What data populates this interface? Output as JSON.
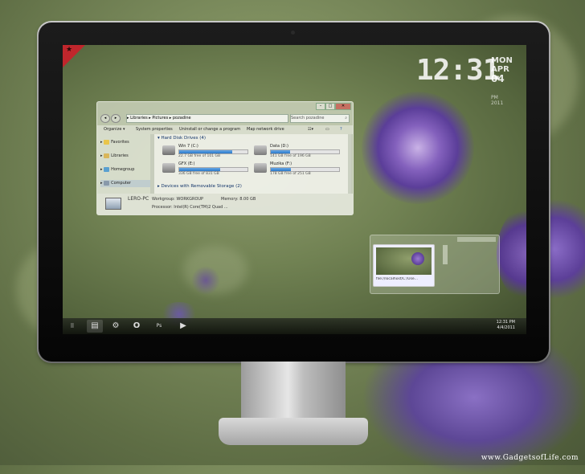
{
  "clock": {
    "time": "12:31",
    "month_top": "MON",
    "month": "APR",
    "day": "04",
    "year": "PM 2011"
  },
  "explorer": {
    "window_controls": [
      "–",
      "□",
      "✕"
    ],
    "breadcrumb": "▸ Libraries ▸ Pictures ▸ pozadine",
    "search_placeholder": "Search pozadine",
    "commands": [
      "Organize ▾",
      "System properties",
      "Uninstall or change a program",
      "Map network drive"
    ],
    "nav": [
      {
        "label": "Favorites",
        "color": "#e9c54a"
      },
      {
        "label": "Libraries",
        "color": "#d9b65a"
      },
      {
        "label": "Homegroup",
        "color": "#5aa0d0"
      },
      {
        "label": "Computer",
        "color": "#8899aa"
      }
    ],
    "groups": {
      "hdd": "Hard Disk Drives (4)",
      "removable": "Devices with Removable Storage (2)"
    },
    "drives": [
      {
        "name": "Win 7 (C:)",
        "free": "22.7 GB free of 101 GB",
        "used": 0.78
      },
      {
        "name": "Data (D:)",
        "free": "141 GB free of 196 GB",
        "used": 0.28
      },
      {
        "name": "GFX (E:)",
        "free": "336 GB free of 831 GB",
        "used": 0.6
      },
      {
        "name": "Muzika (F:)",
        "free": "178 GB free of 251 GB",
        "used": 0.29
      }
    ],
    "details": {
      "pc_name": "LERO-PC",
      "workgroup": "Workgroup: WORKGROUP",
      "memory": "Memory: 8.00 GB",
      "processor": "Processor: Intel(R) Core(TM)2 Quad ..."
    }
  },
  "thumbnail": {
    "label": "file://localhost/C:/Use..."
  },
  "taskbar": {
    "icons": [
      {
        "name": "start-icon",
        "glyph": "⠿"
      },
      {
        "name": "explorer-icon",
        "glyph": "▤"
      },
      {
        "name": "settings-icon",
        "glyph": "⚙"
      },
      {
        "name": "opera-icon",
        "glyph": "O"
      },
      {
        "name": "photoshop-icon",
        "glyph": "Ps"
      },
      {
        "name": "media-player-icon",
        "glyph": "▶"
      }
    ],
    "tray_time": "12:31 PM",
    "tray_date": "4/4/2011"
  },
  "watermark": "www.GadgetsofLife.com",
  "colors": {
    "accent_red": "#c0262c",
    "progress_blue": "#2b79c8",
    "flower": "#6e4fa8"
  }
}
